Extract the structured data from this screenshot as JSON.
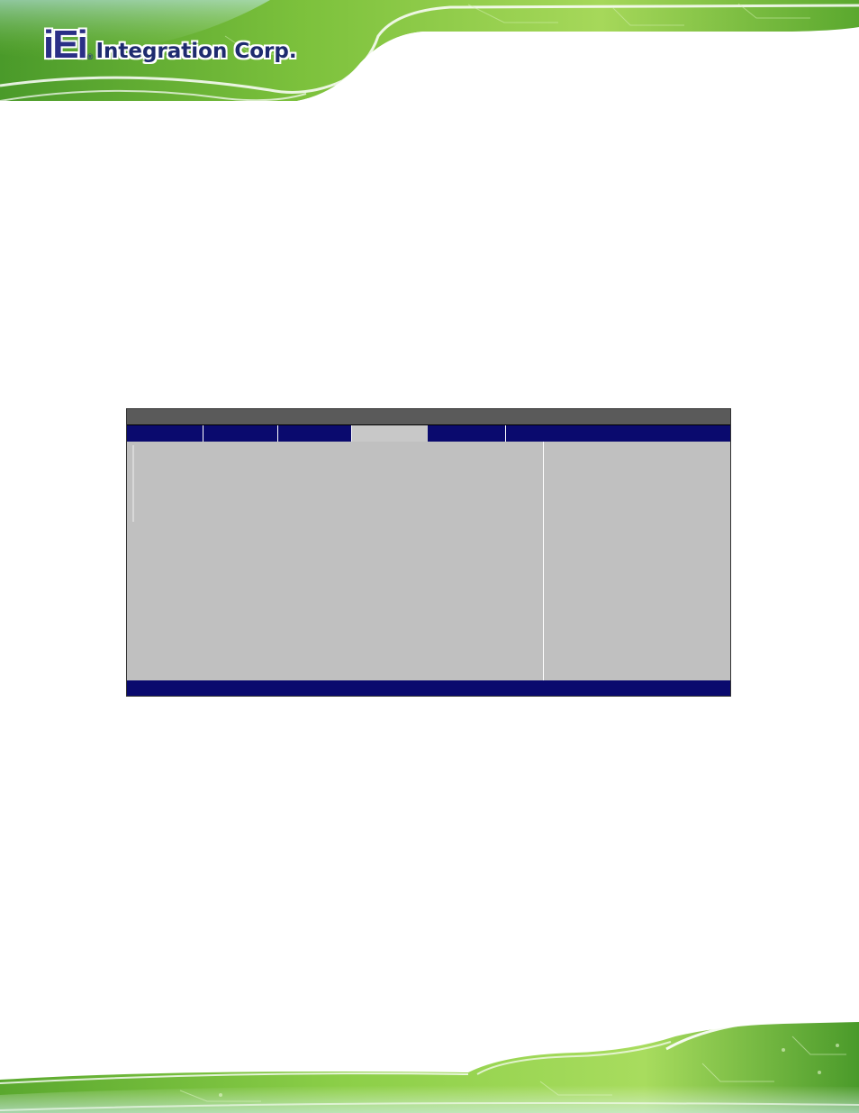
{
  "header": {
    "logo": {
      "mark": "iEi",
      "registered": "®",
      "company": "Integration Corp."
    },
    "colors": {
      "green_dark": "#3f8f1e",
      "green_light": "#9ad64a",
      "logo_navy": "#2a2f86"
    }
  },
  "bios_screen": {
    "colors": {
      "title_bar": "#5a5a5a",
      "tab_bar": "#0a0a6e",
      "active_tab": "#c8c8c8",
      "body": "#c0c0c0",
      "status_bar": "#0a0a6e"
    },
    "tabs": [
      {
        "label": "",
        "active": false
      },
      {
        "label": "",
        "active": false
      },
      {
        "label": "",
        "active": false
      },
      {
        "label": "",
        "active": true
      },
      {
        "label": "",
        "active": false
      }
    ]
  },
  "footer": {
    "colors": {
      "green_dark": "#3f8f1e",
      "green_light": "#9ad64a"
    }
  }
}
